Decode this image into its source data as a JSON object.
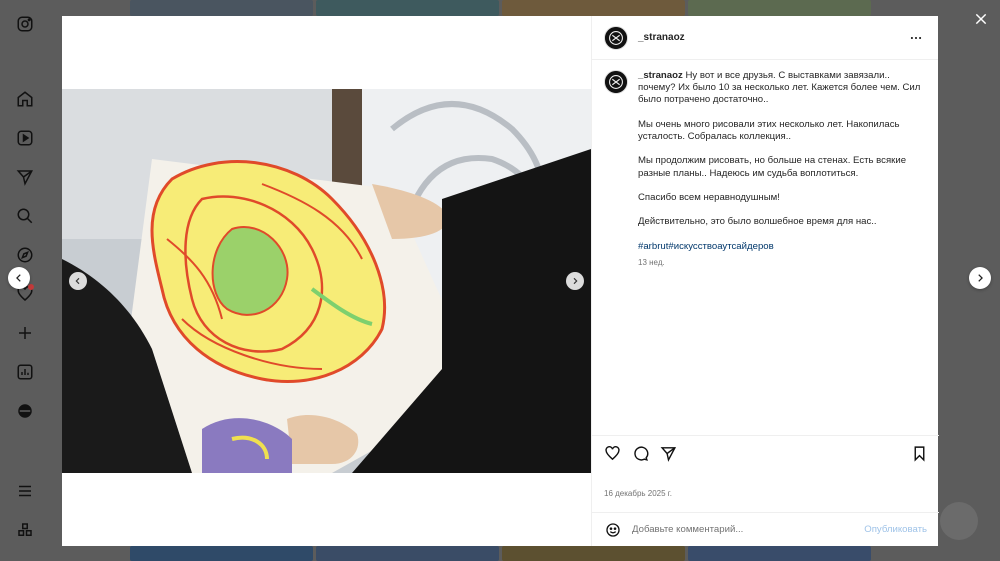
{
  "post": {
    "username": "_stranaoz",
    "caption_username": "_stranaoz",
    "caption_lines": [
      "Ну вот и все друзья. С выставками завязали.. почему? Их было 10 за несколько лет. Кажется более чем. Сил было потрачено достаточно..",
      "Мы очень много рисовали этих несколько лет. Накопилась усталость. Собралась коллекция..",
      "Мы продолжим рисовать, но больше на стенах. Есть всякие разные планы.. Надеюсь им судьба воплотиться.",
      "Спасибо всем неравнодушным!",
      "Действительно, это было волшебное время для нас.."
    ],
    "hashtags": [
      "#arbrut",
      "#искусствоаутсайдеров"
    ],
    "time_ago": "13 нед.",
    "date": "16 декабрь 2025 г."
  },
  "comment": {
    "placeholder": "Добавьте комментарий...",
    "publish_label": "Опубликовать"
  },
  "icons": {
    "nav": [
      "instagram-icon",
      "home-icon",
      "reels-icon",
      "direct-icon",
      "search-icon",
      "explore-icon",
      "notifications-icon",
      "create-icon",
      "dashboard-icon",
      "profile-icon",
      "menu-icon",
      "also-from-meta-icon"
    ],
    "actions": [
      "like-icon",
      "comment-icon",
      "share-icon",
      "save-icon"
    ]
  },
  "colors": {
    "overlay": "#5c5c5c",
    "link": "#00376b",
    "publish_disabled": "#9fc3e8",
    "notification_dot": "#c23a3a"
  }
}
